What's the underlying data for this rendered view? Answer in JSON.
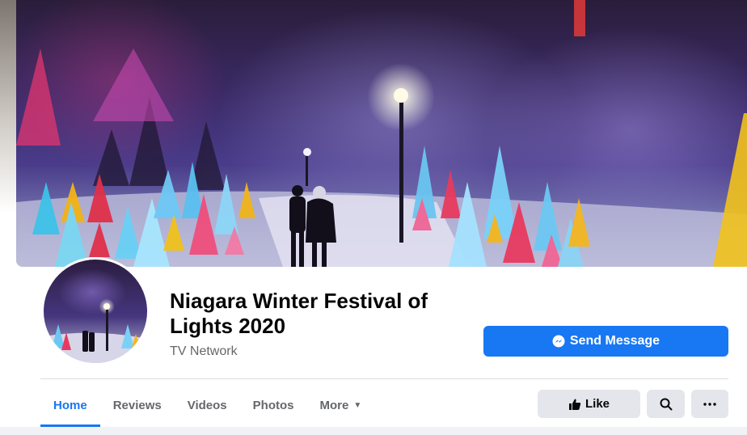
{
  "cover": {
    "description_icon": "winter-lights-photo"
  },
  "profile": {
    "title": "Niagara Winter Festival of Lights 2020",
    "category": "TV Network"
  },
  "actions": {
    "send_message_label": "Send Message",
    "like_label": "Like"
  },
  "tabs": [
    {
      "label": "Home",
      "active": true
    },
    {
      "label": "Reviews",
      "active": false
    },
    {
      "label": "Videos",
      "active": false
    },
    {
      "label": "Photos",
      "active": false
    },
    {
      "label": "More",
      "active": false
    }
  ],
  "icons": {
    "messenger": "messenger-icon",
    "like": "thumbs-up-icon",
    "search": "search-icon",
    "more": "ellipsis-icon",
    "caret": "caret-down-icon"
  },
  "colors": {
    "accent": "#1877f2",
    "button_gray": "#e4e6eb",
    "text_secondary": "#65676b"
  }
}
